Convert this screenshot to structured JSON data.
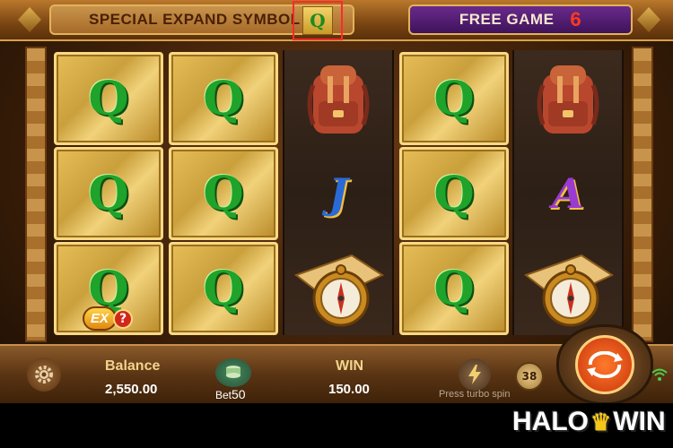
{
  "header": {
    "special_label": "SPECIAL EXPAND SYMBOL",
    "special_symbol": "Q",
    "free_game_label": "FREE GAME",
    "free_game_count": "6"
  },
  "reels": {
    "col1": [
      "Q",
      "Q",
      "Q"
    ],
    "col2": [
      "Q",
      "Q",
      "Q"
    ],
    "col3": [
      "backpack-icon",
      "J",
      "compass-icon"
    ],
    "col4": [
      "Q",
      "Q",
      "Q"
    ],
    "col5": [
      "backpack-icon",
      "A",
      "compass-icon"
    ]
  },
  "ex_badge": {
    "label": "EX",
    "help": "?"
  },
  "bottom": {
    "balance_label": "Balance",
    "balance_value": "2,550.00",
    "bet_label": "Bet",
    "bet_value": "50",
    "win_label": "WIN",
    "win_value": "150.00",
    "turbo_text": "Press turbo spin",
    "auto_count": "38"
  },
  "logo": {
    "left": "HALO",
    "right": "WIN"
  }
}
